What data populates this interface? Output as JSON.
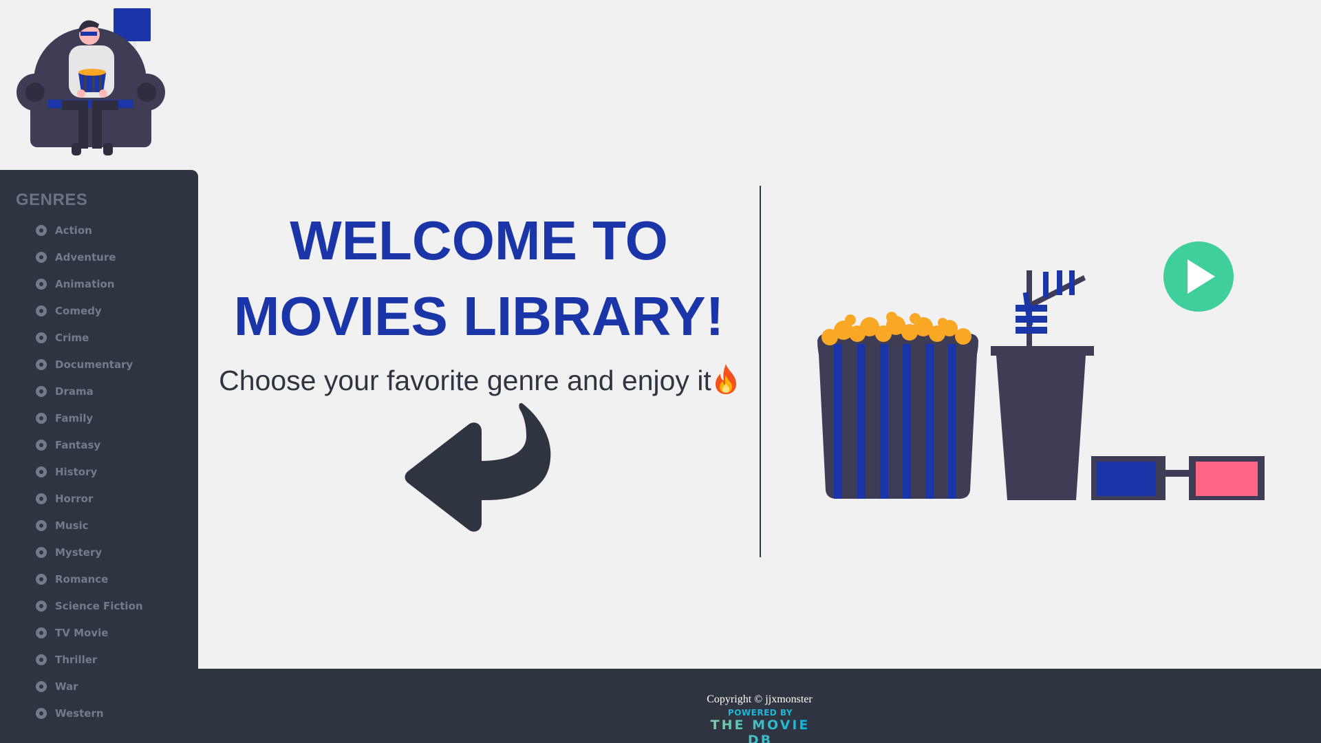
{
  "sidebar": {
    "title": "GENRES",
    "genres": [
      "Action",
      "Adventure",
      "Animation",
      "Comedy",
      "Crime",
      "Documentary",
      "Drama",
      "Family",
      "Fantasy",
      "History",
      "Horror",
      "Music",
      "Mystery",
      "Romance",
      "Science Fiction",
      "TV Movie",
      "Thriller",
      "War",
      "Western"
    ]
  },
  "welcome": {
    "title": "WELCOME TO MOVIES LIBRARY!",
    "subtitle": "Choose your favorite genre and enjoy it"
  },
  "footer": {
    "copyright": "Copyright © jjxmonster",
    "powered_by": "POWERED BY",
    "brand": "THE MOVIE DB"
  },
  "icons": {
    "hero": "person-on-couch-illustration",
    "fire": "fire-emoji-icon",
    "arrow": "curved-arrow-left-icon",
    "snacks": "popcorn-drink-3d-glasses-illustration",
    "play": "play-button-icon",
    "genre_bullet": "radio-icon"
  },
  "colors": {
    "accent": "#1a35a7",
    "sidebar_bg": "#2f3540",
    "page_bg": "#f1f1f1",
    "play_green": "#3ecf9b",
    "popcorn": "#f9a826",
    "glasses_pink": "#ff6584"
  }
}
